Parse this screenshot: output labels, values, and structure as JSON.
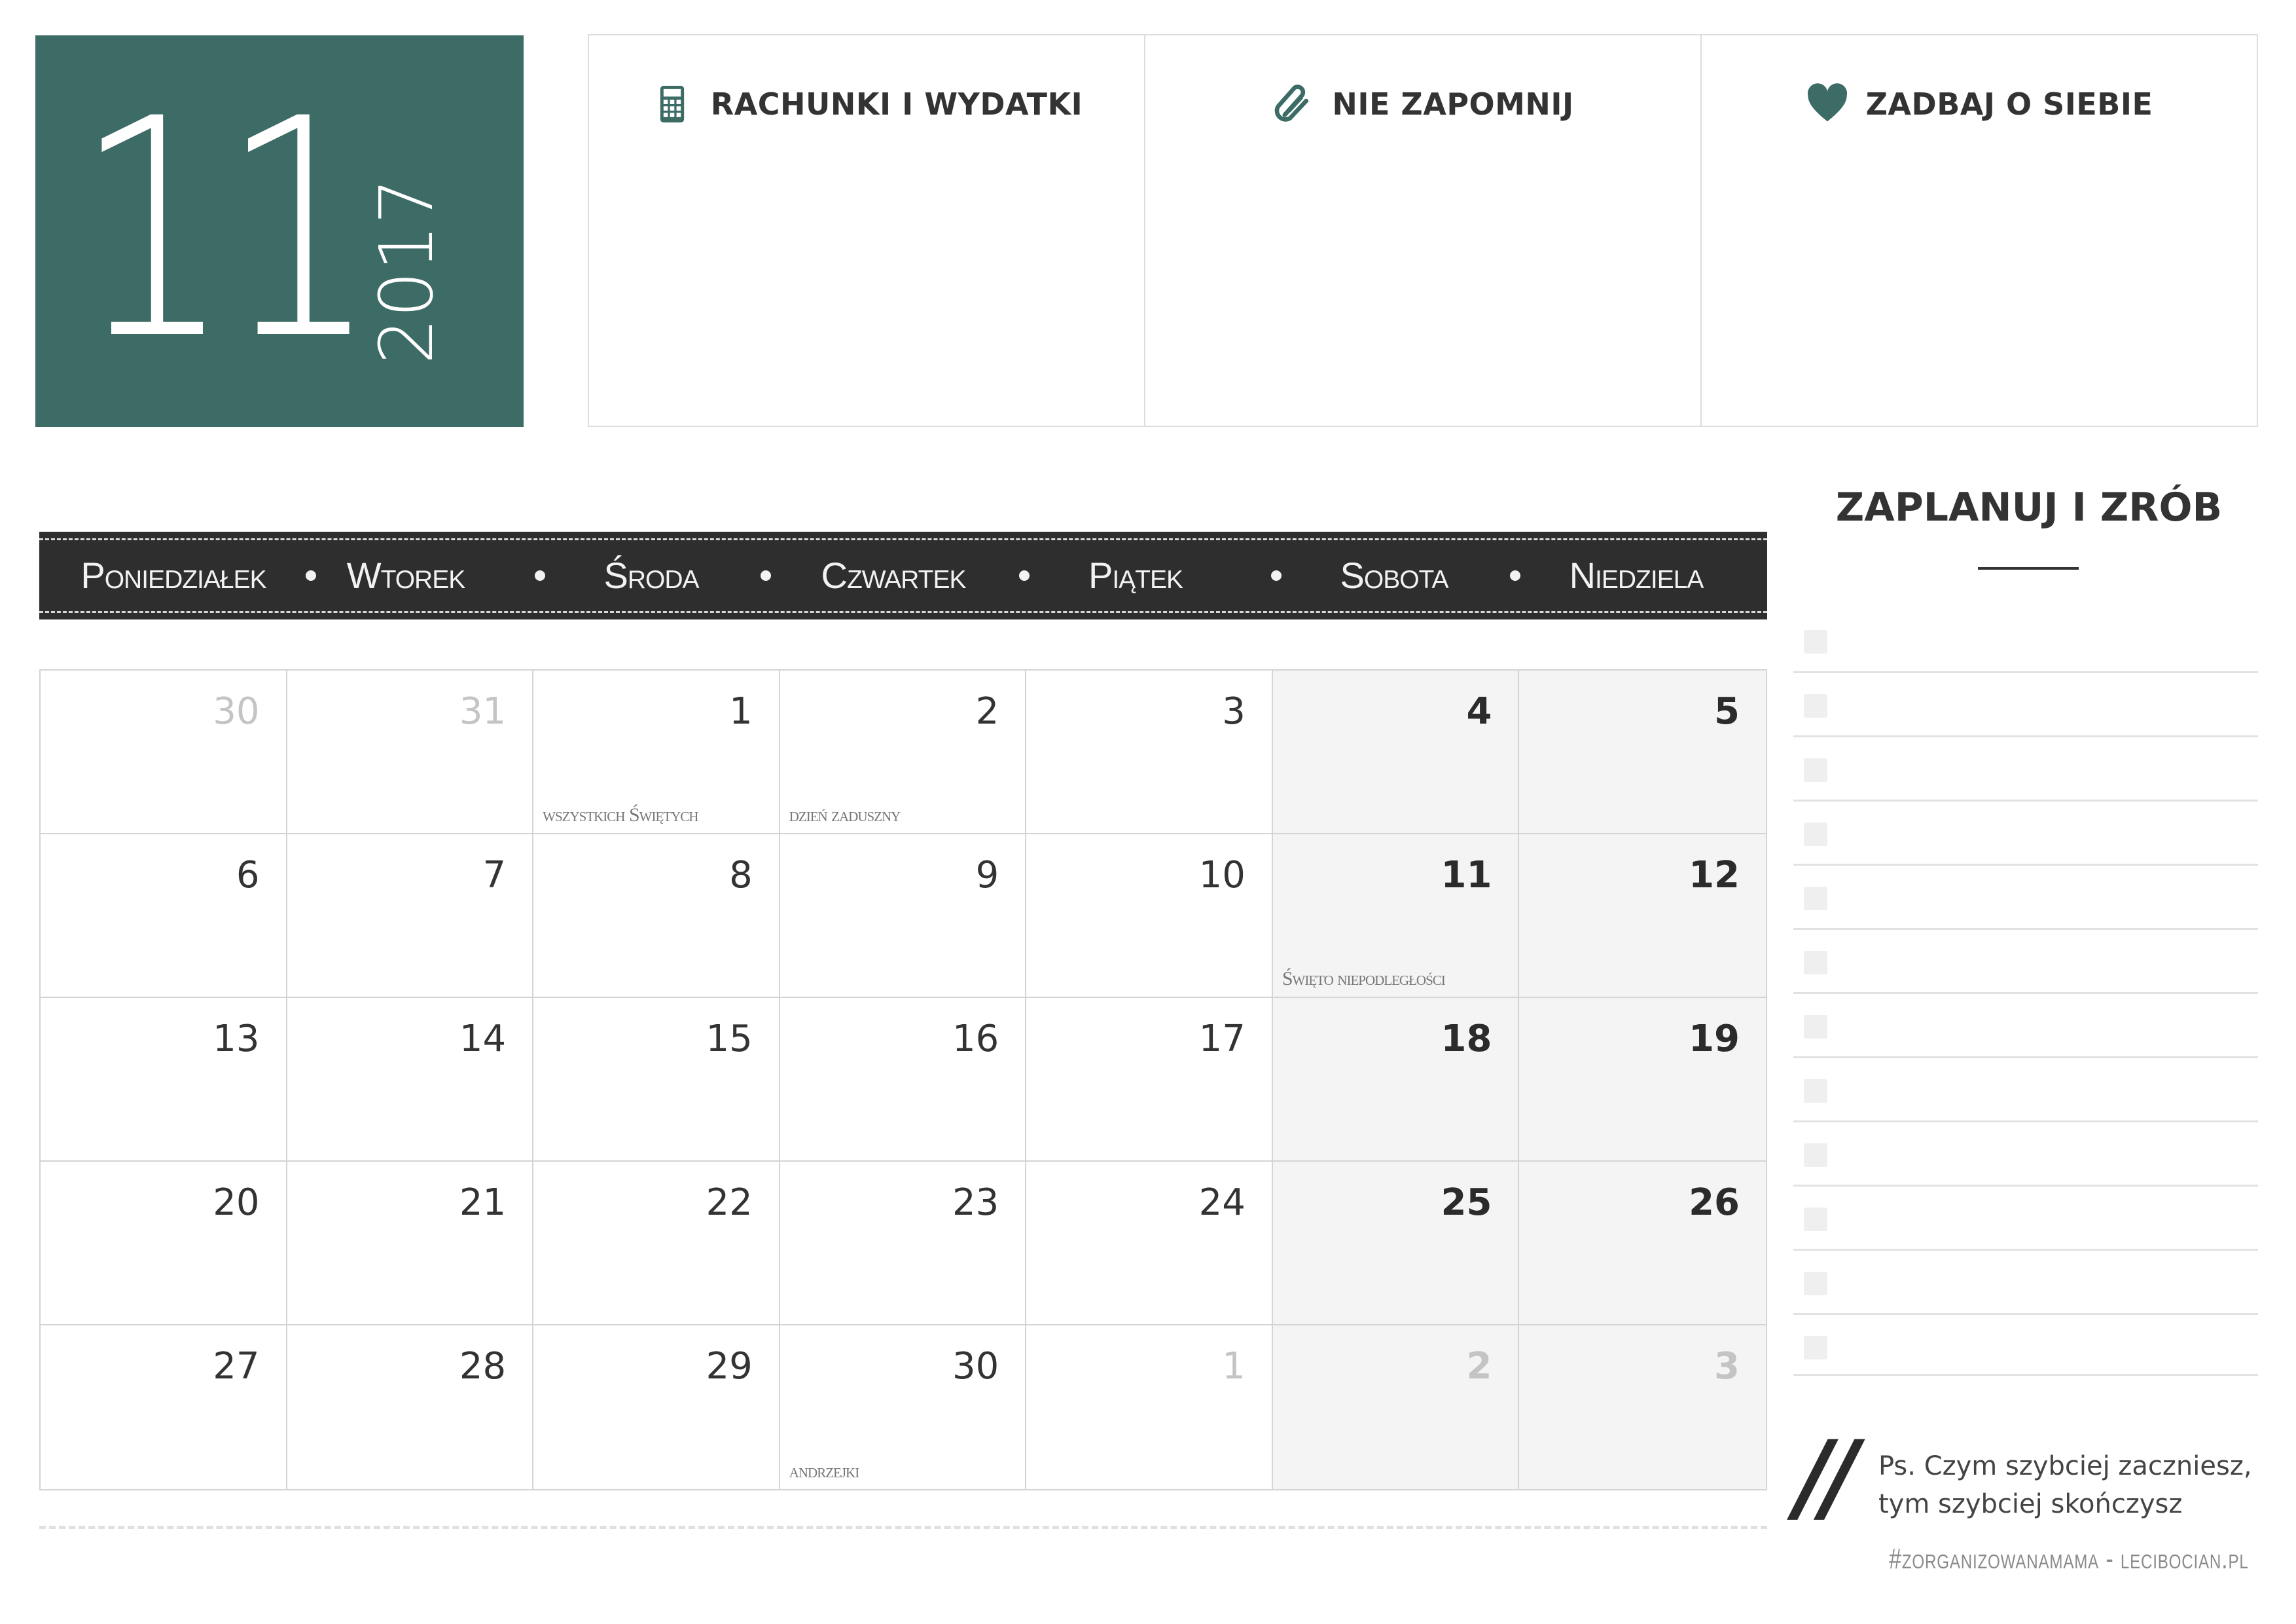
{
  "month": {
    "number": "11",
    "year": "2017"
  },
  "top_boxes": [
    {
      "title": "RACHUNKI I WYDATKI",
      "icon": "calculator-icon"
    },
    {
      "title": "NIE ZAPOMNIJ",
      "icon": "paperclip-icon"
    },
    {
      "title": "ZADBAJ O SIEBIE",
      "icon": "heart-icon"
    }
  ],
  "weekdays": [
    "Poniedziałek",
    "Wtorek",
    "Środa",
    "Czwartek",
    "Piątek",
    "Sobota",
    "Niedziela"
  ],
  "calendar": {
    "weeks": [
      [
        {
          "day": "30",
          "outside": true
        },
        {
          "day": "31",
          "outside": true
        },
        {
          "day": "1",
          "holiday": "wszystkich Świętych"
        },
        {
          "day": "2",
          "holiday": "dzień zaduszny"
        },
        {
          "day": "3"
        },
        {
          "day": "4"
        },
        {
          "day": "5"
        }
      ],
      [
        {
          "day": "6"
        },
        {
          "day": "7"
        },
        {
          "day": "8"
        },
        {
          "day": "9"
        },
        {
          "day": "10"
        },
        {
          "day": "11",
          "holiday": "Święto niepodległości"
        },
        {
          "day": "12"
        }
      ],
      [
        {
          "day": "13"
        },
        {
          "day": "14"
        },
        {
          "day": "15"
        },
        {
          "day": "16"
        },
        {
          "day": "17"
        },
        {
          "day": "18"
        },
        {
          "day": "19"
        }
      ],
      [
        {
          "day": "20"
        },
        {
          "day": "21"
        },
        {
          "day": "22"
        },
        {
          "day": "23"
        },
        {
          "day": "24"
        },
        {
          "day": "25"
        },
        {
          "day": "26"
        }
      ],
      [
        {
          "day": "27"
        },
        {
          "day": "28"
        },
        {
          "day": "29"
        },
        {
          "day": "30",
          "holiday": "andrzejki"
        },
        {
          "day": "1",
          "outside": true
        },
        {
          "day": "2",
          "outside": true
        },
        {
          "day": "3",
          "outside": true
        }
      ]
    ]
  },
  "todo": {
    "title": "ZAPLANUJ I ZRÓB",
    "item_count": 12
  },
  "quote": {
    "mark": "//",
    "text": "Ps. Czym szybciej zaczniesz, tym szybciej skończysz"
  },
  "footer": {
    "tag": "#zorganizowanamama - lecibocian.pl"
  },
  "colors": {
    "accent": "#3d6b65",
    "banner": "#2e2e2e",
    "weekend": "#f4f4f4",
    "outside_day": "#c4c4c4"
  }
}
